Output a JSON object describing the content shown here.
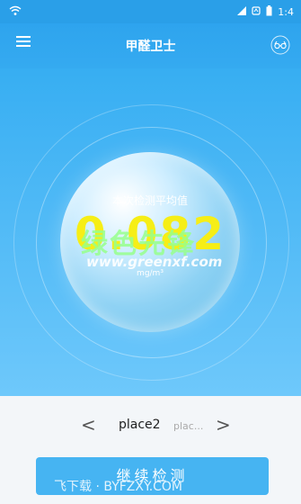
{
  "status_bar": {
    "time": "1:4"
  },
  "header": {
    "title": "甲醛卫士",
    "menu_icon": "menu-icon",
    "glasses_icon": "glasses-icon"
  },
  "reading": {
    "caption": "本次检测平均值",
    "value": "0.082",
    "unit": "mg/m³"
  },
  "watermark": {
    "cn_text": "绿色先锋",
    "url": "www.greenxf.com",
    "bottom": "飞下载 · BYFZXY.COM"
  },
  "places": {
    "prev_symbol": "<",
    "current": "place2",
    "next_preview": "plac...",
    "next_symbol": ">"
  },
  "actions": {
    "continue_label": "继续检测"
  },
  "colors": {
    "primary": "#2ea4ee",
    "value": "#f6ee16",
    "button": "#46b4f2"
  }
}
